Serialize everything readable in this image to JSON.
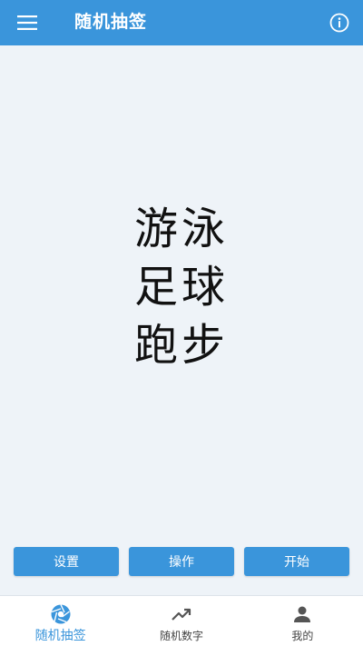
{
  "colors": {
    "primary": "#3a95db",
    "background": "#eef3f8",
    "text": "#111111",
    "tab_inactive": "#444444"
  },
  "appbar": {
    "title": "随机抽签",
    "menu_icon": "menu-icon",
    "info_icon": "info-icon"
  },
  "results": [
    "游泳",
    "足球",
    "跑步"
  ],
  "actions": {
    "settings_label": "设置",
    "operate_label": "操作",
    "start_label": "开始"
  },
  "tabs": [
    {
      "label": "随机抽签",
      "icon": "aperture-icon",
      "active": true
    },
    {
      "label": "随机数字",
      "icon": "trending-up-icon",
      "active": false
    },
    {
      "label": "我的",
      "icon": "person-icon",
      "active": false
    }
  ]
}
